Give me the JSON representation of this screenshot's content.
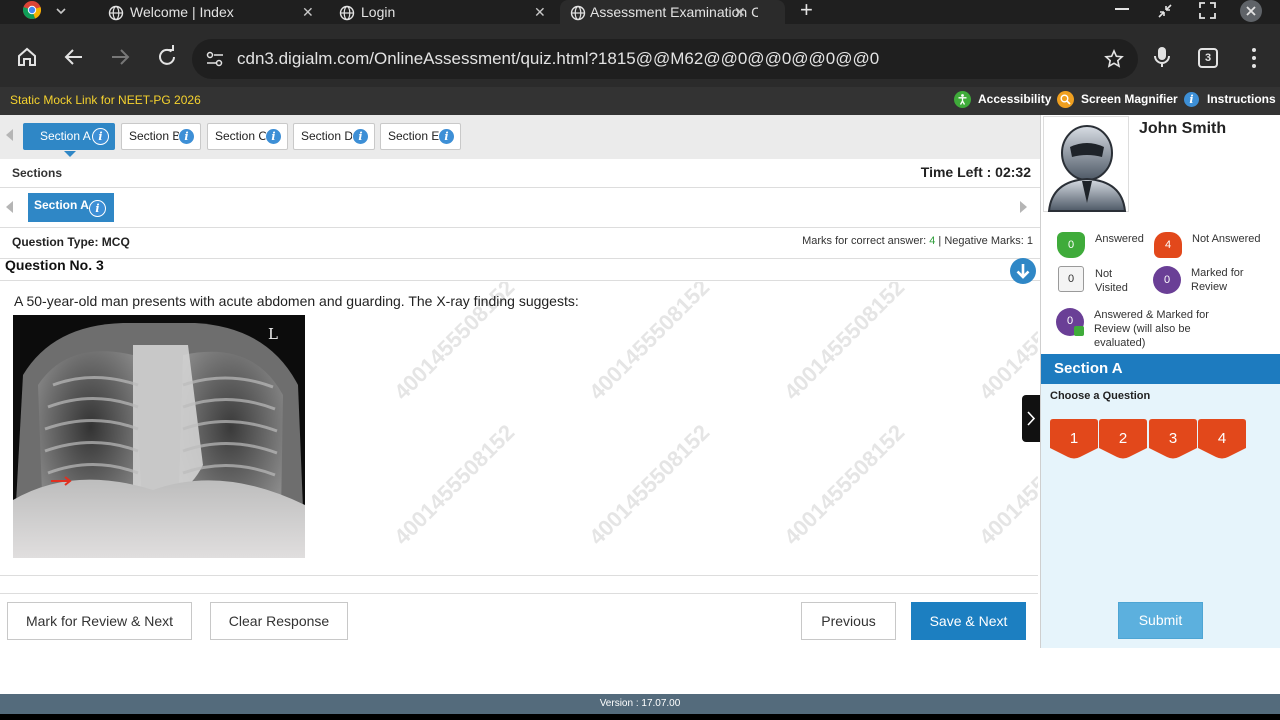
{
  "browser": {
    "tabs": [
      {
        "title": "Welcome | Index",
        "close": "✕"
      },
      {
        "title": "Login",
        "close": "✕"
      },
      {
        "title": "Assessment Examination Ce",
        "close": "✕"
      }
    ],
    "new_tab": "+",
    "url": "cdn3.digialm.com/OnlineAssessment/quiz.html?1815@@M62@@0@@0@@0@@0",
    "tab_count": "3"
  },
  "header": {
    "title": "Static Mock Link for NEET-PG 2026",
    "accessibility": "Accessibility",
    "screen_magnifier": "Screen Magnifier",
    "instructions": "Instructions"
  },
  "sections": {
    "tabs": [
      "Section A",
      "Section B",
      "Section C",
      "Section D",
      "Section E"
    ],
    "active": "Section A",
    "label": "Sections",
    "time_left": "Time Left : 02:32",
    "sub_section": "Section A"
  },
  "question": {
    "type_label": "Question Type: MCQ",
    "marks_prefix": "Marks for correct answer: ",
    "marks_correct": "4",
    "marks_suffix": " | Negative Marks: 1",
    "number": "Question No. 3",
    "text": "A 50-year-old man presents with acute abdomen and guarding. The X-ray finding suggests:",
    "xray_marker": "L",
    "watermark": "4001455508152"
  },
  "actions": {
    "mark_review": "Mark for Review & Next",
    "clear": "Clear Response",
    "previous": "Previous",
    "save_next": "Save & Next",
    "submit": "Submit"
  },
  "profile": {
    "name": "John Smith"
  },
  "legend": {
    "answered_count": "0",
    "answered": "Answered",
    "not_answered_count": "4",
    "not_answered": "Not Answered",
    "not_visited_count": "0",
    "not_visited_1": "Not",
    "not_visited_2": "Visited",
    "marked_count": "0",
    "marked_1": "Marked for",
    "marked_2": "Review",
    "answered_marked_count": "0",
    "answered_marked_1": "Answered & Marked for",
    "answered_marked_2": "Review (will also be",
    "answered_marked_3": "evaluated)"
  },
  "palette": {
    "section_title": "Section A",
    "choose_label": "Choose a Question",
    "questions": [
      "1",
      "2",
      "3",
      "4"
    ]
  },
  "footer": {
    "version": "Version : 17.07.00"
  },
  "colors": {
    "accent": "#2f87c6",
    "not_answered": "#e2481b",
    "answered": "#3fab3a",
    "marked": "#6a3f96"
  }
}
